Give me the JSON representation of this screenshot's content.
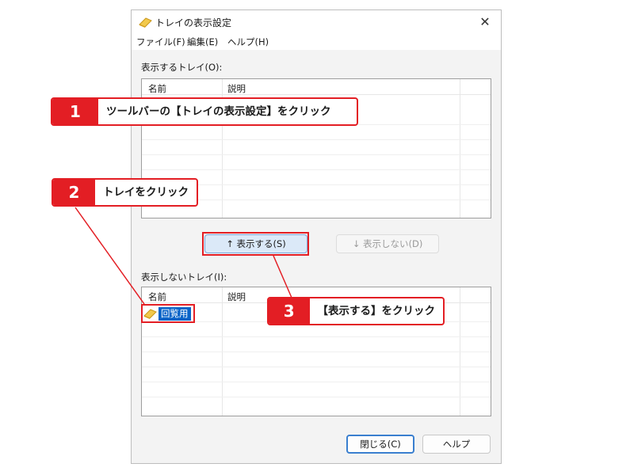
{
  "window": {
    "title": "トレイの表示設定",
    "icon": "tray-icon",
    "close_symbol": "✕"
  },
  "menu": [
    "ファイル(F)",
    "編集(E)",
    "ヘルプ(H)"
  ],
  "shown_trays": {
    "label": "表示するトレイ(O):",
    "columns": [
      "名前",
      "説明"
    ],
    "rows": []
  },
  "buttons": {
    "show": "↑ 表示する(S)",
    "hide": "↓ 表示しない(D)",
    "close": "閉じる(C)",
    "help": "ヘルプ"
  },
  "hidden_trays": {
    "label": "表示しないトレイ(I):",
    "columns": [
      "名前",
      "説明"
    ],
    "rows": [
      {
        "name": "回覧用",
        "description": ""
      }
    ]
  },
  "callouts": [
    {
      "number": "1",
      "text": "ツールバーの【トレイの表示設定】をクリック"
    },
    {
      "number": "2",
      "text": "トレイをクリック"
    },
    {
      "number": "3",
      "text": "【表示する】をクリック"
    }
  ],
  "colors": {
    "accent_red": "#e31e24",
    "selection_blue": "#0a64c8"
  }
}
